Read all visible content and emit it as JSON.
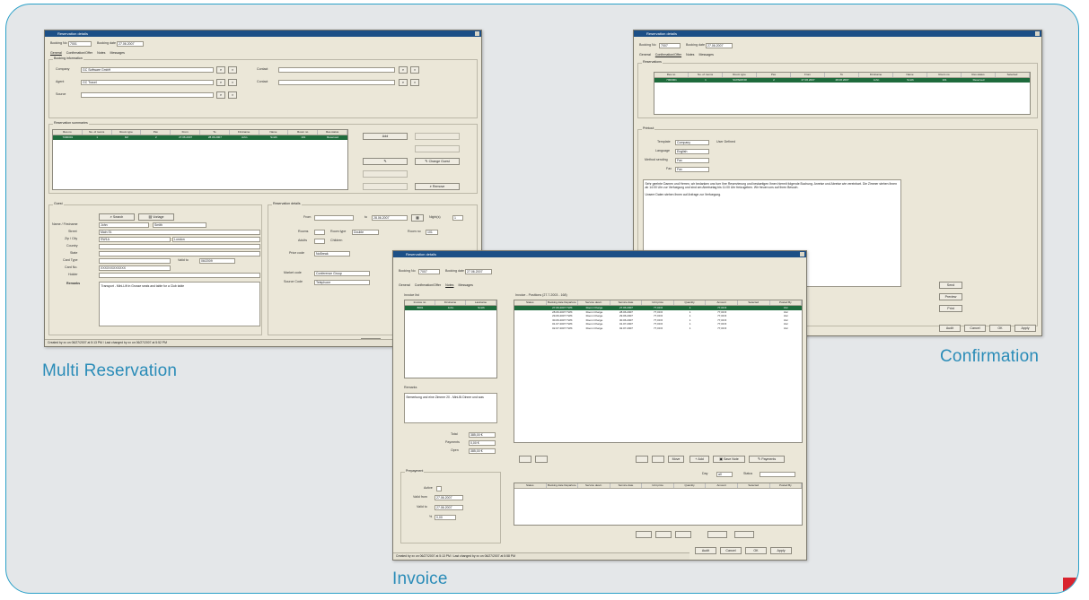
{
  "captions": {
    "multi": "Multi Reservation",
    "confirmation": "Confirmation",
    "invoice": "Invoice"
  },
  "colors": {
    "frame_border": "#2aa0c8",
    "frame_fill": "#e4e7e9",
    "caption": "#2a8cb8",
    "corner_mark": "#d9232e",
    "window_face": "#ebe7d8",
    "title_bar": "#1c4f86",
    "grid_selection": "#1e6b3c"
  },
  "multi": {
    "title": "Reservation details",
    "booking_no_label": "Booking No",
    "booking_no": "7001",
    "booking_date_label": "Booking date",
    "booking_date": "27.06.2007",
    "tabs": [
      "General",
      "Confirmation/Offer",
      "Notes",
      "Messages"
    ],
    "booking_info_title": "Booking information",
    "company_label": "Company",
    "company_value": "GC Software GmbH",
    "agent_label": "Agent",
    "agent_value": "GC Travel",
    "source_label": "Source",
    "contact_label": "Contact",
    "contact2_label": "Contact",
    "reservations_title": "Reservation summaries",
    "grid_headers": [
      "Res.no",
      "No. of rooms",
      "Room type",
      "Pax",
      "From",
      "To",
      "Firstname",
      "Name",
      "Room no",
      "Res.status"
    ],
    "grid_row": [
      "7000001",
      "1",
      "DZ",
      "2",
      "27.06.2007",
      "28.06.2007",
      "John",
      "Smith",
      "101",
      "Reserved"
    ],
    "btn_add": "Add",
    "btn_change_guest": "Change Guest",
    "btn_remove": "Remove",
    "guest_title": "Guest",
    "btn_search": "Search",
    "btn_vorlage": "Vorlage",
    "name_label": "Name / Firstname",
    "name_value": "Smith",
    "firstname_value": "John",
    "street_label": "Street",
    "street_value": "Main St.",
    "zip_label": "Zip / City",
    "zip_value": "SW1A",
    "city_value": "London",
    "country_label": "Country",
    "state_label": "State",
    "card_label": "Card Type",
    "valid_label": "Valid to",
    "valid_value": "06/2009",
    "cardno_label": "Card No.",
    "cardno_value": "XXXXXXXXXXXX",
    "holder_label": "Holder",
    "remarks_label": "Remarks",
    "remarks_value": "Transport - Mini-Lift in Grosse seats and table for a Club table",
    "res_details_title": "Reservation details",
    "from_label": "From",
    "to_label": "to",
    "to_value": "28.06.2007",
    "nights_label": "Night(s)",
    "nights_value": "1",
    "rooms_label": "Rooms",
    "room_type_label": "Room type",
    "room_type_value": "Double",
    "room_no_label": "Room no",
    "room_no_value": "101",
    "adults_label": "Adults",
    "children_label": "Children",
    "price_code_label": "Price code",
    "price_code_value": "NoBreak",
    "market_label": "Market code",
    "market_value": "Conference Group",
    "source_code_label": "Source Code",
    "source_code_value": "Telephone",
    "btn_audit": "Audit",
    "status": "Created by xx on 06/27/2007 at 5:13 PM / Last changed by xx on 06/27/2007 at 5:52 PM"
  },
  "conf": {
    "title": "Reservation details",
    "booking_no_label": "Booking No",
    "booking_no": "7007",
    "booking_date_label": "Booking date",
    "booking_date": "27.06.2007",
    "tabs": [
      "General",
      "Confirmation/Offer",
      "Notes",
      "Messages"
    ],
    "reservations_title": "Reservations",
    "grid_headers": [
      "Res.no",
      "No. of rooms",
      "Room type",
      "Pax",
      "From",
      "To",
      "Firstname",
      "Name",
      "Room no",
      "Res.status",
      "Selected"
    ],
    "grid_row": [
      "7000001",
      "1",
      "SUPERIOR",
      "2",
      "27.06.2007",
      "28.06.2007",
      "John",
      "Smith",
      "101",
      "Reserved",
      ""
    ],
    "printout_title": "Printout",
    "template_label": "Template",
    "template_value": "Company",
    "user_defined": "User Defined",
    "language_label": "Language",
    "language_value": "English",
    "method_label": "Method sending",
    "method_value": "Fax",
    "fax_label": "Fax",
    "fax_value": "Fax",
    "letter_text": "Sehr geehrte Damen und Herren, wir bedanken uns fuer Ihre Reservierung und bestaetigen Ihnen hiermit folgende Buchung. Anreise und Abreise wie vereinbart. Die Zimmer stehen Ihnen ab 14:00 Uhr zur Verfuegung und sind am Abreisetag bis 11:00 Uhr freizugeben. Wir freuen uns auf Ihren Besuch.",
    "letter_note": "Unsere Daten stehen Ihnen auf Anfrage zur Verfuegung.",
    "btn_send": "Send",
    "btn_preview": "Preview",
    "btn_print": "Print",
    "btn_audit": "Audit",
    "btn_cancel": "Cancel",
    "btn_ok": "OK",
    "btn_apply": "Apply"
  },
  "inv": {
    "title": "Reservation details",
    "booking_no_label": "Booking No",
    "booking_no": "7007",
    "booking_date_label": "Booking date",
    "booking_date": "27.06.2007",
    "tabs": [
      "General",
      "Confirmation/Offer",
      "Notes",
      "Messages"
    ],
    "invoice_list_title": "Invoice list",
    "list_headers": [
      "Invoice no",
      "Firstname",
      "Lastname"
    ],
    "list_row": [
      "8001",
      "John",
      "Smith"
    ],
    "positions_title": "Invoice - Positions (27.7.2003 - 168)",
    "pos_headers": [
      "Status",
      "Booking date Departure",
      "Service descr.",
      "Service date",
      "Unit price",
      "Quantity",
      "Amount",
      "Selected",
      "Posted By"
    ],
    "pos_rows": [
      [
        "",
        "27.06.2007 TWK",
        "Room Charge",
        "27.06.2007",
        "77,00 €",
        "1",
        "77,00 €",
        "",
        "Ucc"
      ],
      [
        "",
        "28.06.2007 TWK",
        "Room Charge",
        "28.06.2007",
        "77,00 €",
        "1",
        "77,00 €",
        "",
        "Ucc"
      ],
      [
        "",
        "29.06.2007 TWK",
        "Room Charge",
        "29.06.2007",
        "77,00 €",
        "1",
        "77,00 €",
        "",
        "Ucc"
      ],
      [
        "",
        "30.06.2007 TWK",
        "Room Charge",
        "30.06.2007",
        "77,00 €",
        "1",
        "77,00 €",
        "",
        "Ucc"
      ],
      [
        "",
        "01.07.2007 TWK",
        "Room Charge",
        "01.07.2007",
        "77,00 €",
        "1",
        "77,00 €",
        "",
        "Ucc"
      ],
      [
        "",
        "02.07.2007 TWK",
        "Room Charge",
        "02.07.2007",
        "77,00 €",
        "1",
        "77,00 €",
        "",
        "Ucc"
      ]
    ],
    "remarks_label": "Remarks",
    "remarks_value": "Bemerkung und eine Zimmer 20 - Mini-Bi Dinner und was",
    "total_label": "Total",
    "total_value": "385,00 €",
    "payments_label": "Payments",
    "payments_value": "0,00 €",
    "open_label": "Open",
    "open_value": "385,00 €",
    "btn_move": "Move",
    "btn_add": "Add",
    "btn_save_note": "Save Note",
    "btn_payments": "Payments",
    "day_label": "Day",
    "all_label": "all",
    "status_label": "Status",
    "prepayment_title": "Prepayment",
    "active_label": "Active",
    "valid_from_label": "Valid from",
    "valid_from_value": "27.06.2007",
    "valid_to_label": "Valid to",
    "valid_to_value": "27.06.2007",
    "pct_label": "%",
    "pct_value": "0,00",
    "lower_headers": [
      "Status",
      "Booking date Departure",
      "Service descr.",
      "Service date",
      "Unit price",
      "Quantity",
      "Amount",
      "Selected",
      "Posted By"
    ],
    "btn_audit": "Audit",
    "btn_cancel": "Cancel",
    "btn_ok": "OK",
    "btn_apply": "Apply",
    "status": "Created by xx on 06/27/2007 at 5:13 PM / Last changed by xx on 06/27/2007 at 5:58 PM"
  }
}
